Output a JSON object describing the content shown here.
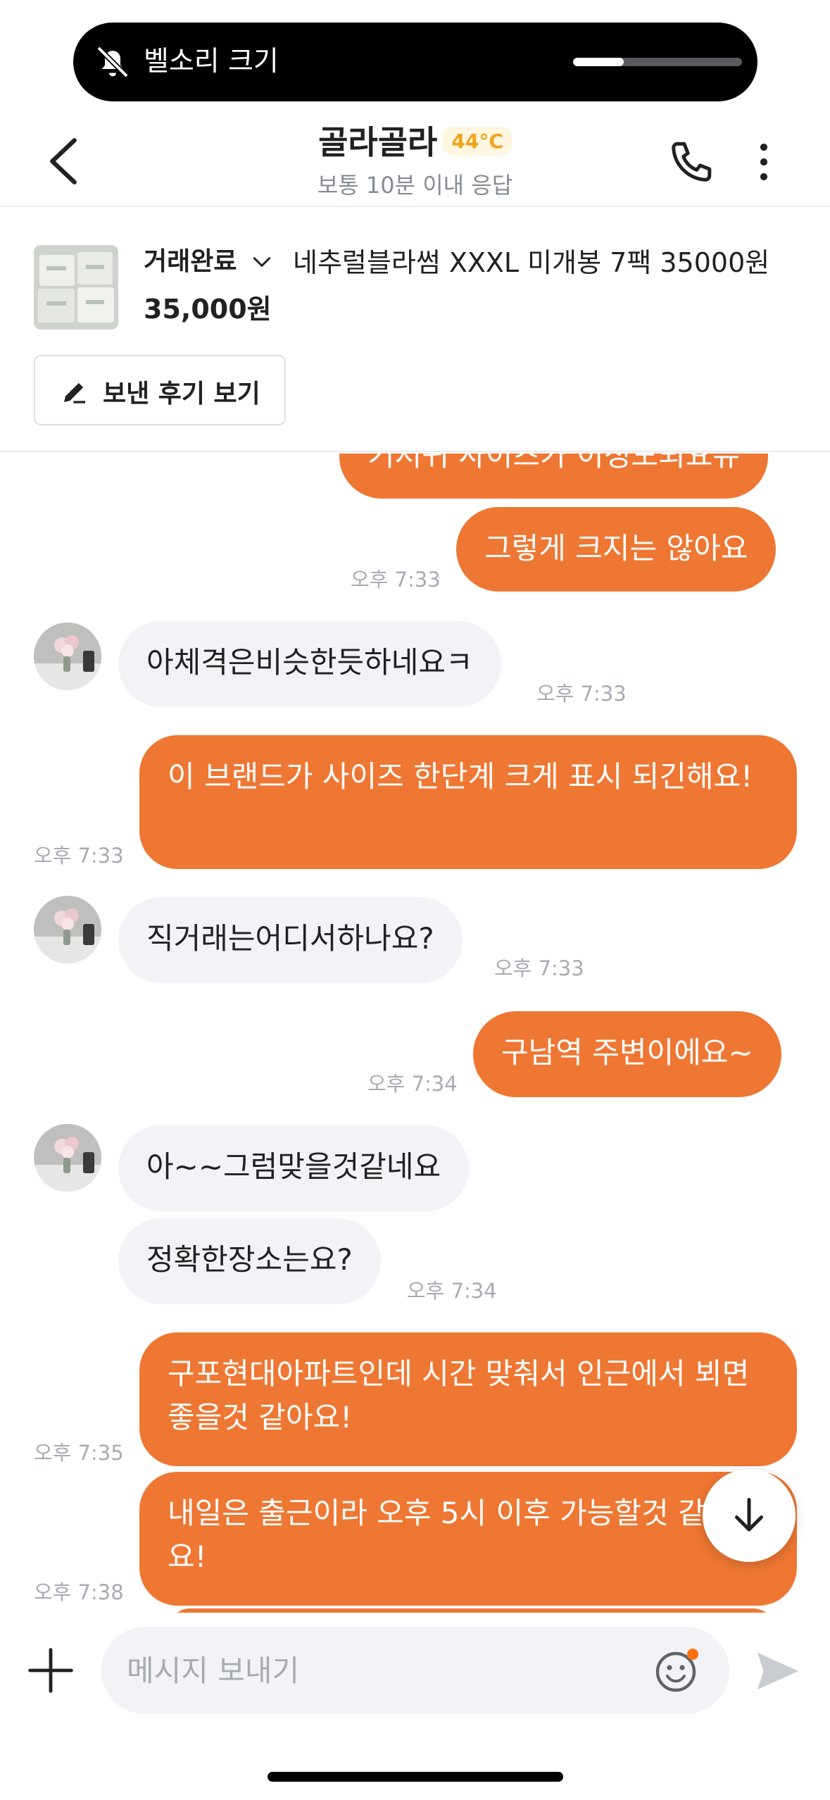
{
  "hud": {
    "label": "벨소리 크기",
    "volume_level": 0.3
  },
  "header": {
    "title": "골라골라",
    "temperature": "44°C",
    "subtitle": "보통 10분 이내 응답"
  },
  "product": {
    "status": "거래완료",
    "title": "네추럴블라썸 XXXL 미개봉 7팩 35000원",
    "price": "35,000원",
    "review_button": "보낸 후기 보기"
  },
  "messages": [
    {
      "type": "out",
      "text": "기저귀 사이즈가 이정도되요뉴",
      "time": ""
    },
    {
      "type": "out",
      "text": "그렇게 크지는 않아요",
      "time": "오후 7:33"
    },
    {
      "type": "in",
      "text": "아체격은비슷한듯하네요ㅋ",
      "time": "오후 7:33"
    },
    {
      "type": "out",
      "text": "이 브랜드가 사이즈 한단계 크게 표시 되긴해요!",
      "time": "오후 7:33"
    },
    {
      "type": "in",
      "text": "직거래는어디서하나요?",
      "time": "오후 7:33"
    },
    {
      "type": "out",
      "text": "구남역 주변이에요~",
      "time": "오후 7:34"
    },
    {
      "type": "in",
      "text": "아~~그럼맞을것같네요",
      "time": ""
    },
    {
      "type": "in",
      "text": "정확한장소는요?",
      "time": "오후 7:34"
    },
    {
      "type": "out",
      "text": "구포현대아파트인데 시간 맞춰서 인근에서 뵈면 좋을것 같아요!",
      "time": "오후 7:35"
    },
    {
      "type": "out",
      "text": "내일은 출근이라 오후 5시 이후 가능할것 같구요!",
      "time": "오후 7:38"
    }
  ],
  "composer": {
    "placeholder": "메시지 보내기"
  },
  "icons": {
    "back": "chevron-left-icon",
    "phone": "phone-icon",
    "more": "more-vertical-icon",
    "bell_off": "bell-off-icon",
    "pen": "pen-icon",
    "plus": "plus-icon",
    "emoji": "emoji-icon",
    "send": "send-icon",
    "scroll_down": "arrow-down-icon"
  },
  "colors": {
    "accent": "#ee7733",
    "incoming_bubble": "#f2f3f6",
    "temperature": "#f0a41c",
    "muted_text": "#868b94",
    "notification_dot": "#ff6f0f"
  }
}
